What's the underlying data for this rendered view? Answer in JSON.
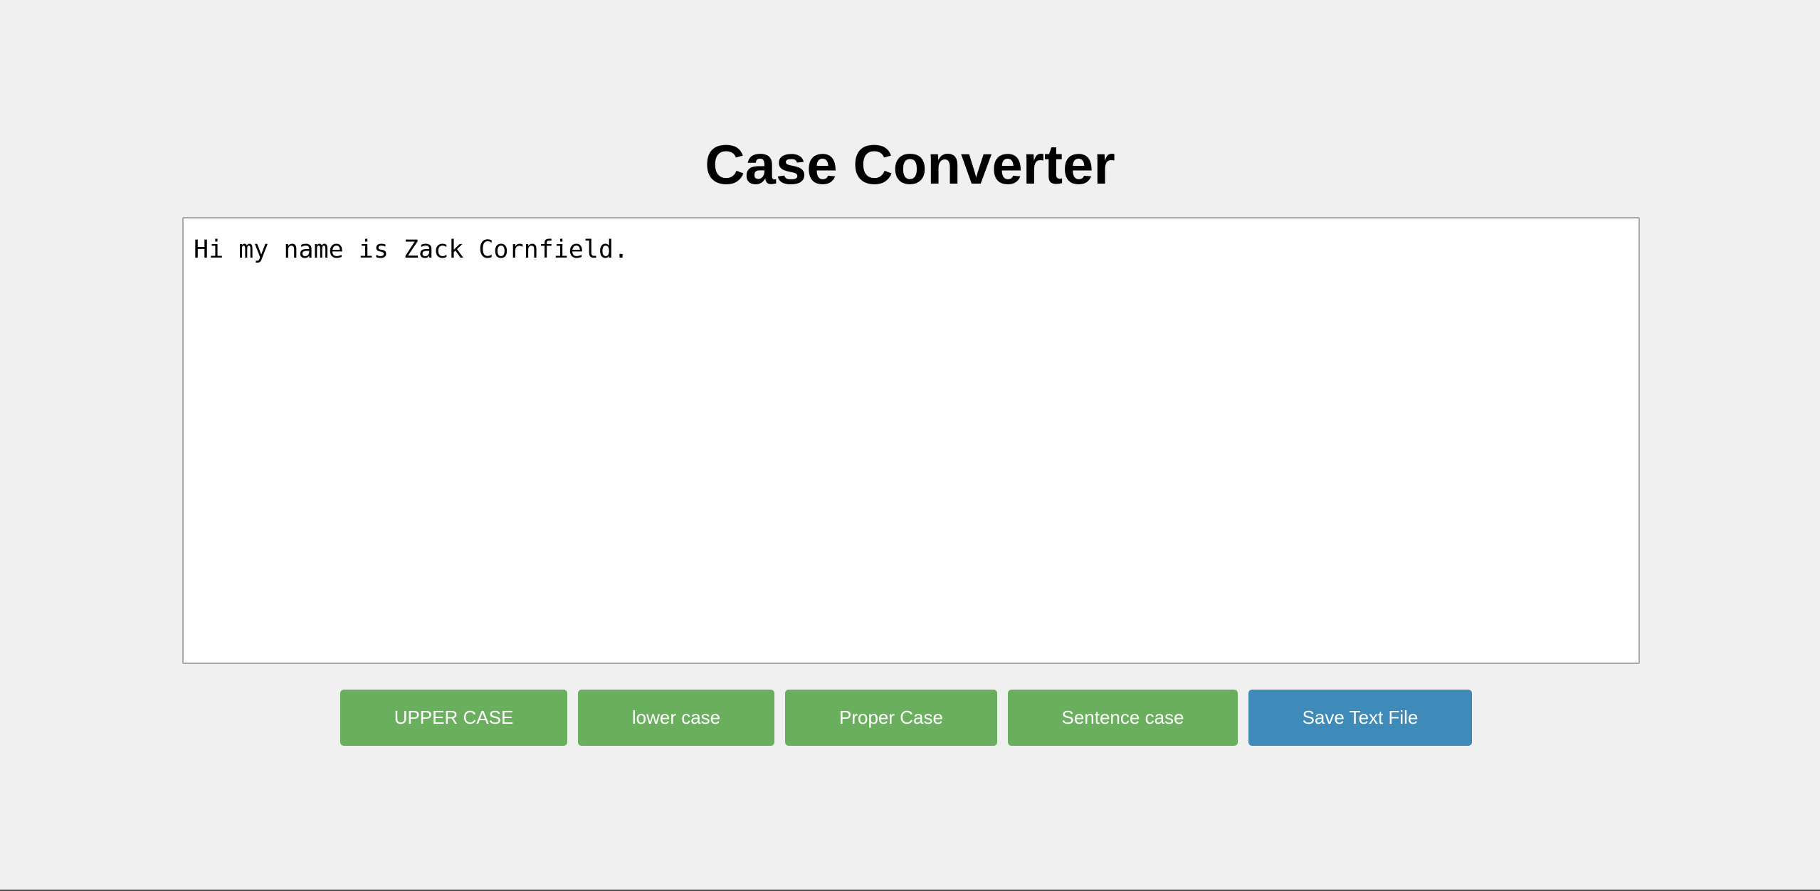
{
  "app": {
    "title": "Case Converter"
  },
  "editor": {
    "value": "Hi my name is Zack Cornfield."
  },
  "buttons": {
    "upper": "UPPER CASE",
    "lower": "lower case",
    "proper": "Proper Case",
    "sentence": "Sentence case",
    "save": "Save Text File"
  },
  "colors": {
    "background": "#f0f0f0",
    "green_button": "#6aaf5d",
    "blue_button": "#3e8ab8",
    "button_text": "#ffffff"
  }
}
